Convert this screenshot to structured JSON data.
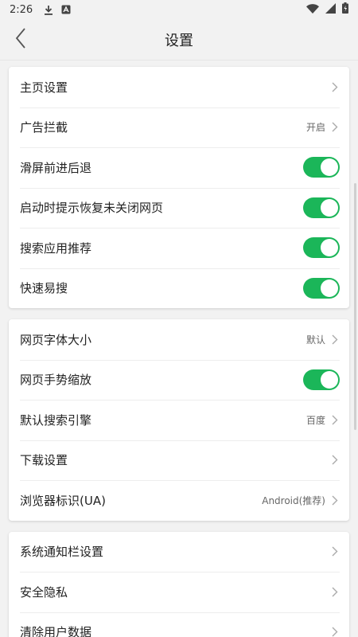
{
  "status_bar": {
    "time": "2:26"
  },
  "header": {
    "title": "设置"
  },
  "groups": [
    {
      "items": [
        {
          "label": "主页设置",
          "value": "",
          "control": "chevron"
        },
        {
          "label": "广告拦截",
          "value": "开启",
          "control": "chevron"
        },
        {
          "label": "滑屏前进后退",
          "value": "",
          "control": "toggle",
          "on": true
        },
        {
          "label": "启动时提示恢复未关闭网页",
          "value": "",
          "control": "toggle",
          "on": true
        },
        {
          "label": "搜索应用推荐",
          "value": "",
          "control": "toggle",
          "on": true
        },
        {
          "label": "快速易搜",
          "value": "",
          "control": "toggle",
          "on": true
        }
      ]
    },
    {
      "items": [
        {
          "label": "网页字体大小",
          "value": "默认",
          "control": "chevron"
        },
        {
          "label": "网页手势缩放",
          "value": "",
          "control": "toggle",
          "on": true
        },
        {
          "label": "默认搜索引擎",
          "value": "百度",
          "control": "chevron"
        },
        {
          "label": "下载设置",
          "value": "",
          "control": "chevron"
        },
        {
          "label": "浏览器标识(UA)",
          "value": "Android(推荐)",
          "control": "chevron"
        }
      ]
    },
    {
      "items": [
        {
          "label": "系统通知栏设置",
          "value": "",
          "control": "chevron"
        },
        {
          "label": "安全隐私",
          "value": "",
          "control": "chevron"
        },
        {
          "label": "清除用户数据",
          "value": "",
          "control": "chevron"
        }
      ]
    }
  ],
  "colors": {
    "accent": "#1bb659",
    "background": "#f2f2f2"
  },
  "icons": {
    "back": "back-arrow-icon",
    "chevron": "chevron-right-icon",
    "download": "download-icon",
    "notification": "app-notification-icon",
    "wifi": "wifi-icon",
    "signal": "signal-icon",
    "battery": "battery-icon"
  }
}
